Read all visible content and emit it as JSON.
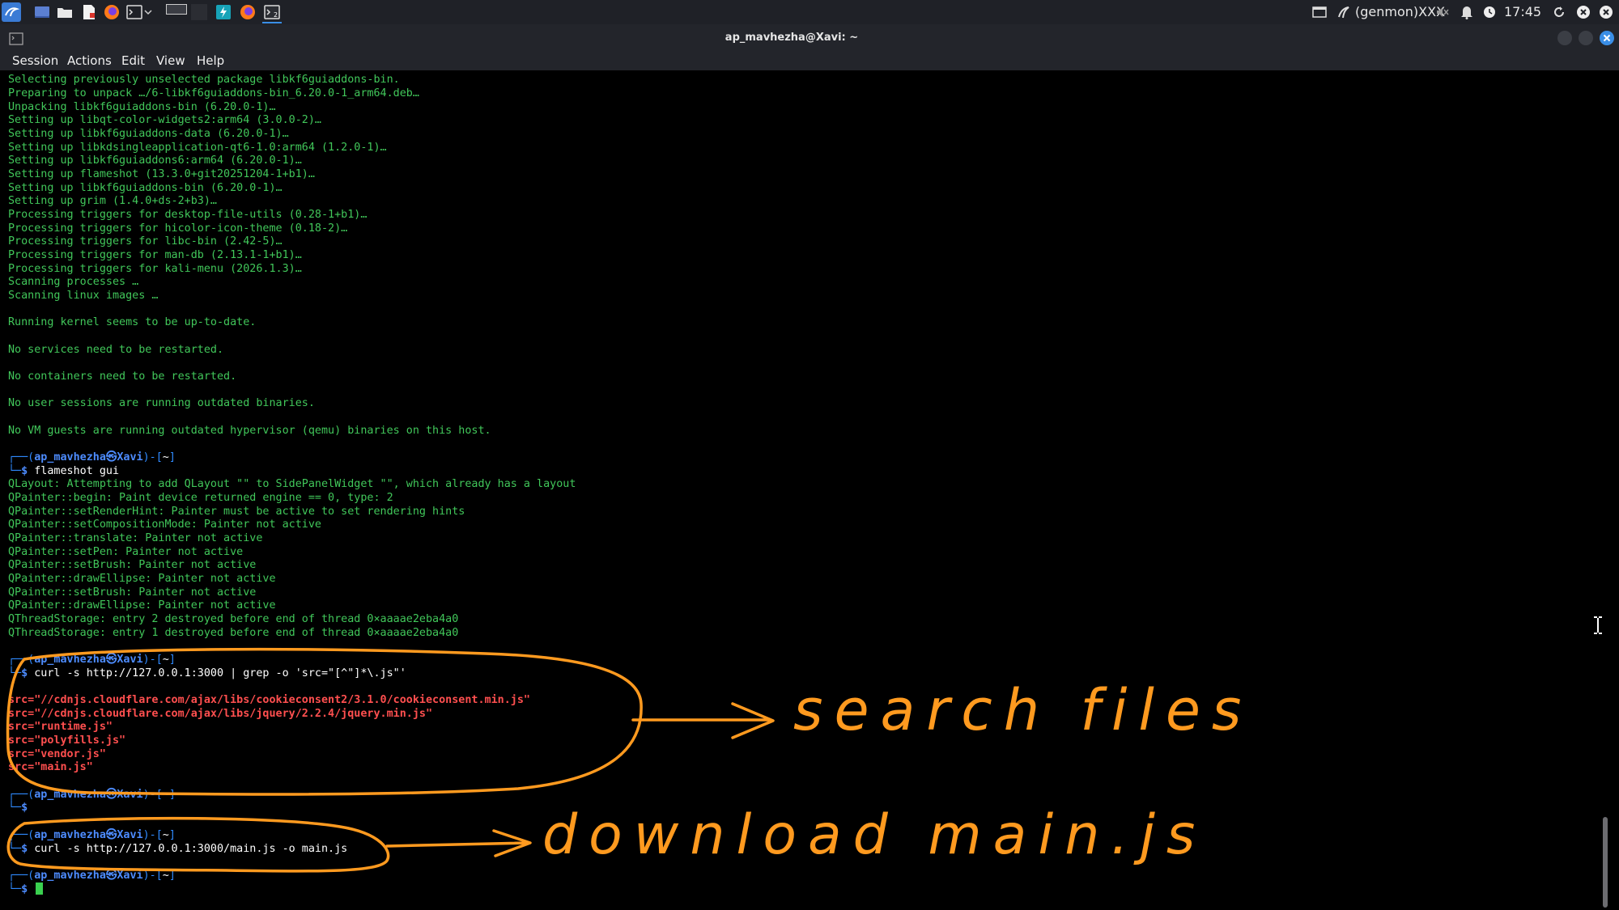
{
  "panel": {
    "applet": "(genmon)XXX",
    "clock": "17:45"
  },
  "window": {
    "title": "ap_mavhezha@Xavi: ~"
  },
  "menu": [
    "Session",
    "Actions",
    "Edit",
    "View",
    "Help"
  ],
  "terminal": {
    "output_top": [
      "Selecting previously unselected package libkf6guiaddons-bin.",
      "Preparing to unpack …/6-libkf6guiaddons-bin_6.20.0-1_arm64.deb…",
      "Unpacking libkf6guiaddons-bin (6.20.0-1)…",
      "Setting up libqt-color-widgets2:arm64 (3.0.0-2)…",
      "Setting up libkf6guiaddons-data (6.20.0-1)…",
      "Setting up libkdsingleapplication-qt6-1.0:arm64 (1.2.0-1)…",
      "Setting up libkf6guiaddons6:arm64 (6.20.0-1)…",
      "Setting up flameshot (13.3.0+git20251204-1+b1)…",
      "Setting up libkf6guiaddons-bin (6.20.0-1)…",
      "Setting up grim (1.4.0+ds-2+b3)…",
      "Processing triggers for desktop-file-utils (0.28-1+b1)…",
      "Processing triggers for hicolor-icon-theme (0.18-2)…",
      "Processing triggers for libc-bin (2.42-5)…",
      "Processing triggers for man-db (2.13.1-1+b1)…",
      "Processing triggers for kali-menu (2026.1.3)…",
      "Scanning processes …",
      "Scanning linux images …",
      "",
      "Running kernel seems to be up-to-date.",
      "",
      "No services need to be restarted.",
      "",
      "No containers need to be restarted.",
      "",
      "No user sessions are running outdated binaries.",
      "",
      "No VM guests are running outdated hypervisor (qemu) binaries on this host."
    ],
    "prompt_user": "ap_mavhezha",
    "prompt_host": "Xavi",
    "prompt_dir": "~",
    "cmd1": "flameshot gui",
    "output_flameshot": [
      "QLayout: Attempting to add QLayout \"\" to SidePanelWidget \"\", which already has a layout",
      "QPainter::begin: Paint device returned engine == 0, type: 2",
      "QPainter::setRenderHint: Painter must be active to set rendering hints",
      "QPainter::setCompositionMode: Painter not active",
      "QPainter::translate: Painter not active",
      "QPainter::setPen: Painter not active",
      "QPainter::setBrush: Painter not active",
      "QPainter::drawEllipse: Painter not active",
      "QPainter::setBrush: Painter not active",
      "QPainter::drawEllipse: Painter not active",
      "QThreadStorage: entry 2 destroyed before end of thread 0×aaaae2eba4a0",
      "QThreadStorage: entry 1 destroyed before end of thread 0×aaaae2eba4a0"
    ],
    "cmd2_a": "curl -s http://127.0.0.1:3000",
    "cmd2_pipe": "|",
    "cmd2_b": "grep -o 'src=\"[^\"]*\\.js\"'",
    "output_grep": [
      "src=\"//cdnjs.cloudflare.com/ajax/libs/cookieconsent2/3.1.0/cookieconsent.min.js\"",
      "src=\"//cdnjs.cloudflare.com/ajax/libs/jquery/2.2.4/jquery.min.js\"",
      "src=\"runtime.js\"",
      "src=\"polyfills.js\"",
      "src=\"vendor.js\"",
      "src=\"main.js\""
    ],
    "cmd3": "curl -s http://127.0.0.1:3000/main.js -o main.js"
  },
  "annotations": {
    "label1": "search files",
    "label2": "download main.js",
    "color": "#ff9a1f"
  }
}
